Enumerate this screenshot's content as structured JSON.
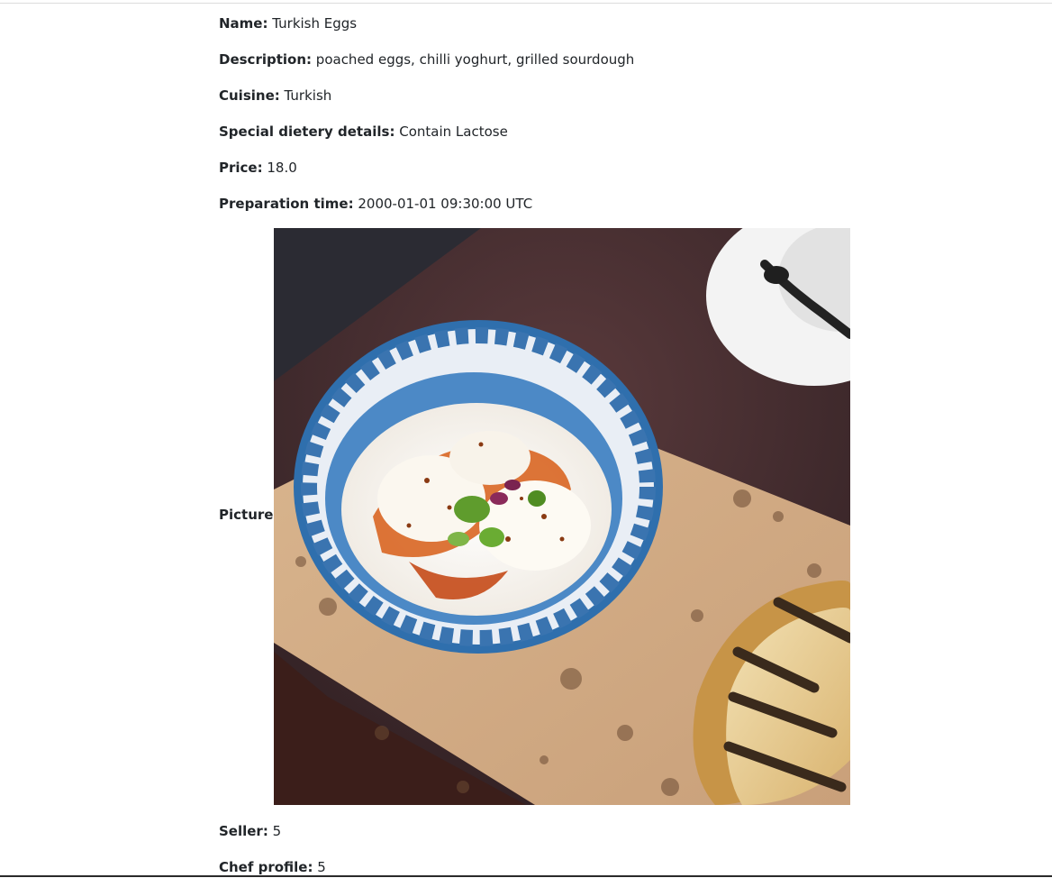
{
  "fields": [
    {
      "label": "Name:",
      "value": "Turkish Eggs"
    },
    {
      "label": "Description:",
      "value": "poached eggs, chilli yoghurt, grilled sourdough"
    },
    {
      "label": "Cuisine:",
      "value": "Turkish"
    },
    {
      "label": "Special dietery details:",
      "value": "Contain Lactose"
    },
    {
      "label": "Price:",
      "value": "18.0"
    },
    {
      "label": "Preparation time:",
      "value": "2000-01-01 09:30:00 UTC"
    }
  ],
  "picture": {
    "label": "Picture:",
    "alt": "Turkish eggs in blue patterned bowl with grilled sourdough"
  },
  "after_fields": [
    {
      "label": "Seller:",
      "value": "5"
    },
    {
      "label": "Chef profile:",
      "value": "5"
    }
  ]
}
